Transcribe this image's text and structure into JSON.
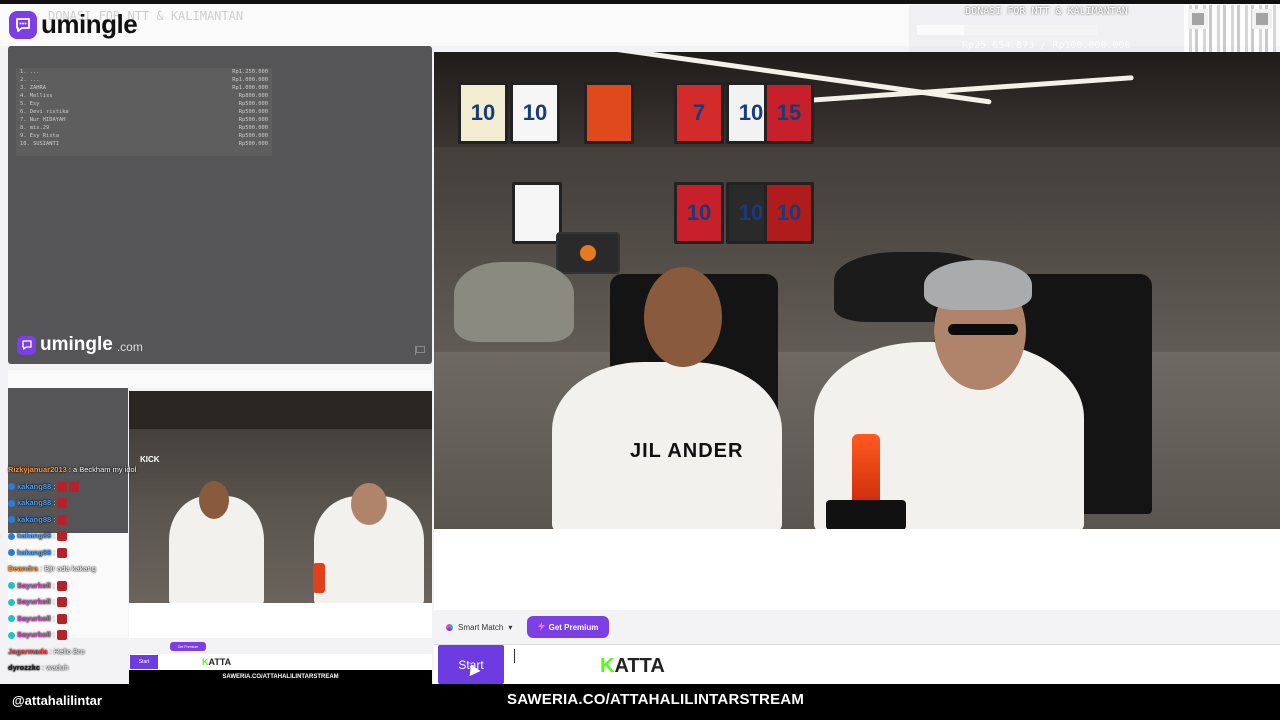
{
  "app": {
    "brand": "umingle",
    "brand_domain_name": "umingle",
    "brand_domain_suffix": ".com",
    "accent_color": "#7b3fe4"
  },
  "overlay": {
    "left_title": "DONASI FOR NTT & KALIMANTAN",
    "donation_title": "DONASI FOR NTT & KALIMANTAN",
    "donation_progress": "Rp25.654.873 / Rp100.000.000",
    "donation_fraction": 0.26,
    "leaderboard": [
      {
        "name": "1. ...",
        "amount": "Rp1.250.000"
      },
      {
        "name": "2. ...",
        "amount": "Rp1.000.000"
      },
      {
        "name": "3. ZAHRA",
        "amount": "Rp1.000.000"
      },
      {
        "name": "4. Melliss",
        "amount": "Rp800.000"
      },
      {
        "name": "5. Esy",
        "amount": "Rp500.000"
      },
      {
        "name": "6. Devi ristika",
        "amount": "Rp500.000"
      },
      {
        "name": "7. Nur HIDAYAH",
        "amount": "Rp500.000"
      },
      {
        "name": "8. mis.29",
        "amount": "Rp500.000"
      },
      {
        "name": "9. Esy Rista",
        "amount": "Rp500.000"
      },
      {
        "name": "10. SUSIANTI",
        "amount": "Rp500.000"
      }
    ]
  },
  "video": {
    "shirt_text": "JIL ANDER",
    "jerseys": [
      "10",
      "10",
      "",
      "7",
      "10",
      "15",
      "",
      "10",
      "10",
      "10"
    ]
  },
  "controls": {
    "smart_match_label": "Smart Match",
    "smart_match_caret": "▾",
    "premium_label": "Get Premium",
    "start_label": "Start",
    "katta_logo": "ATTA",
    "katta_k": "K"
  },
  "mini": {
    "start_label": "Start",
    "premium_label": "Get Premium",
    "katta_logo": "ATTA",
    "katta_k": "K",
    "saweria": "SAWERIA.CO/ATTAHALILINTARSTREAM",
    "kick_label": "KICK"
  },
  "chat": [
    {
      "user": "Rizkyjanuar2013",
      "msg": ": a Beckham my idol",
      "color": "#ff9a3c",
      "emotes": 0
    },
    {
      "user": "kakang88",
      "msg": ":",
      "color": "#4aa3ff",
      "emotes": 2
    },
    {
      "user": "kakang88",
      "msg": ":",
      "color": "#4aa3ff",
      "emotes": 1
    },
    {
      "user": "kakang88",
      "msg": ":",
      "color": "#4aa3ff",
      "emotes": 1
    },
    {
      "user": "kakang88",
      "msg": ":",
      "color": "#4aa3ff",
      "emotes": 1
    },
    {
      "user": "kakang88",
      "msg": ":",
      "color": "#4aa3ff",
      "emotes": 1
    },
    {
      "user": "Deandra",
      "msg": ": Bjir ada kakang",
      "color": "#ff9a3c",
      "emotes": 0
    },
    {
      "user": "Sayurkoll",
      "msg": ":",
      "color": "#e14cd2",
      "emotes": 1
    },
    {
      "user": "Sayurkoll",
      "msg": ":",
      "color": "#e14cd2",
      "emotes": 1
    },
    {
      "user": "Sayurkoll",
      "msg": ":",
      "color": "#e14cd2",
      "emotes": 1
    },
    {
      "user": "Sayurkoll",
      "msg": ":",
      "color": "#e14cd2",
      "emotes": 1
    },
    {
      "user": "Jagarmada",
      "msg": ": Hello Bro",
      "color": "#ff4a4a",
      "emotes": 0
    },
    {
      "user": "dyrozzkc",
      "msg": ": waduh",
      "color": "#222222",
      "emotes": 0
    }
  ],
  "footer": {
    "handle": "@attahalilintar",
    "saweria": "SAWERIA.CO/ATTAHALILINTARSTREAM"
  }
}
